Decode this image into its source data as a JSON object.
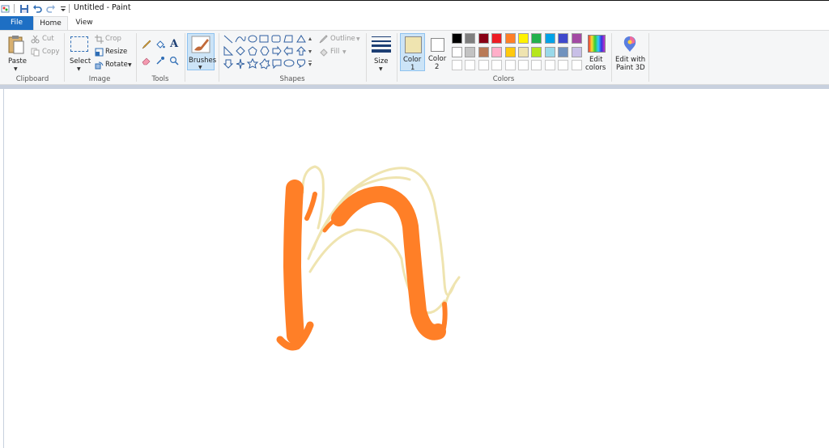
{
  "window": {
    "title": "Untitled - Paint"
  },
  "quick_access": {
    "items": [
      "paint-app-icon",
      "save-icon",
      "undo-icon",
      "redo-icon",
      "customize-dropdown-icon"
    ]
  },
  "tabs": [
    {
      "label": "File"
    },
    {
      "label": "Home"
    },
    {
      "label": "View"
    }
  ],
  "ribbon": {
    "clipboard": {
      "group": "Clipboard",
      "paste": "Paste",
      "cut": "Cut",
      "copy": "Copy"
    },
    "image": {
      "group": "Image",
      "select": "Select",
      "crop": "Crop",
      "resize": "Resize",
      "rotate": "Rotate"
    },
    "tools": {
      "group": "Tools"
    },
    "brushes": {
      "label": "Brushes"
    },
    "shapes": {
      "group": "Shapes",
      "outline": "Outline",
      "fill": "Fill"
    },
    "size": {
      "label": "Size"
    },
    "colors": {
      "group": "Colors",
      "color1": {
        "line1": "Color",
        "line2": "1",
        "value": "#efe4b0"
      },
      "color2": {
        "line1": "Color",
        "line2": "2",
        "value": "#ffffff"
      },
      "palette_row1": [
        "#000000",
        "#7f7f7f",
        "#880015",
        "#ed1c24",
        "#ff7f27",
        "#fff200",
        "#22b14c",
        "#00a2e8",
        "#3f48cc",
        "#a349a4"
      ],
      "palette_row2": [
        "#ffffff",
        "#c3c3c3",
        "#b97a57",
        "#ffaec9",
        "#ffc90e",
        "#efe4b0",
        "#b5e61d",
        "#99d9ea",
        "#7092be",
        "#c8bfe7"
      ],
      "palette_row3": [
        "#ffffff",
        "#ffffff",
        "#ffffff",
        "#ffffff",
        "#ffffff",
        "#ffffff",
        "#ffffff",
        "#ffffff",
        "#ffffff",
        "#ffffff"
      ],
      "edit": {
        "line1": "Edit",
        "line2": "colors"
      }
    },
    "paint3d": {
      "line1": "Edit with",
      "line2": "Paint 3D"
    }
  },
  "drawing": {
    "orange": "#ff7f27",
    "cream": "#efe4b0"
  }
}
